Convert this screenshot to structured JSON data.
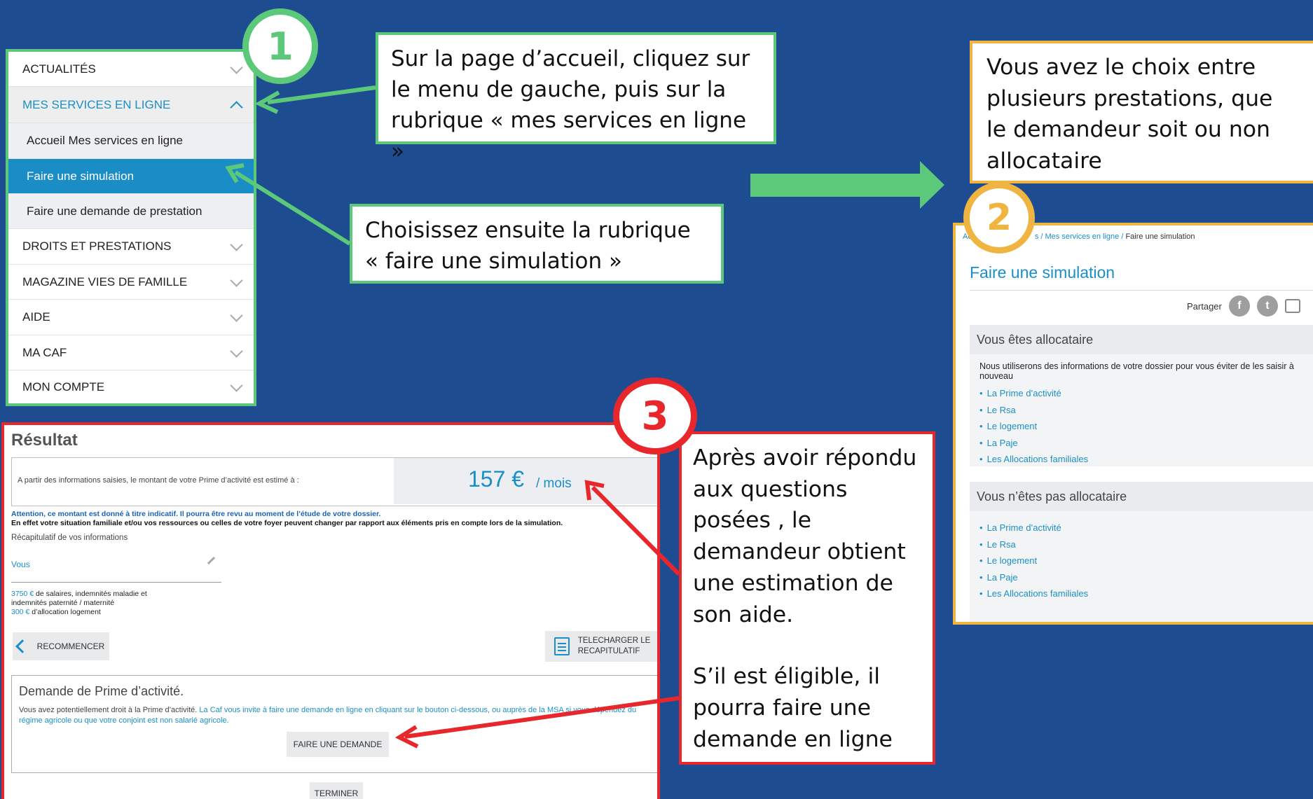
{
  "menu": {
    "items": [
      {
        "label": "ACTUALITÉS",
        "state": "collapsed"
      },
      {
        "label": "MES SERVICES EN LIGNE",
        "state": "expanded"
      },
      {
        "label": "Accueil Mes services en ligne",
        "state": "subitem"
      },
      {
        "label": "Faire une simulation",
        "state": "selected"
      },
      {
        "label": "Faire une demande de prestation",
        "state": "subitem"
      },
      {
        "label": "DROITS ET PRESTATIONS",
        "state": "collapsed"
      },
      {
        "label": "MAGAZINE VIES DE FAMILLE",
        "state": "collapsed"
      },
      {
        "label": "AIDE",
        "state": "collapsed"
      },
      {
        "label": "MA CAF",
        "state": "collapsed"
      },
      {
        "label": "MON COMPTE",
        "state": "collapsed"
      }
    ]
  },
  "badges": {
    "one": "1",
    "two": "2",
    "three": "3"
  },
  "callouts": {
    "step1": "Sur la page d’accueil, cliquez sur le menu de gauche, puis sur la rubrique « mes services en ligne »",
    "step1b": "Choisissez ensuite la rubrique « faire une simulation »",
    "step2": "Vous avez le choix entre plusieurs prestations, que le demandeur soit ou non allocataire",
    "step3a": "Après avoir répondu aux questions posées , le demandeur obtient une estimation de son aide.",
    "step3b": "S’il est éligible, il pourra faire une demande en ligne"
  },
  "simulation_page": {
    "breadcrumb_start": "Ac",
    "breadcrumb_middle": "s / Mes services en ligne / ",
    "breadcrumb_current": "Faire une simulation",
    "title": "Faire une simulation",
    "share_label": "Partager",
    "allocataire": {
      "heading": "Vous êtes allocataire",
      "intro": "Nous utiliserons des informations de votre dossier pour vous éviter de les saisir à nouveau",
      "links": [
        "La Prime d’activité",
        "Le Rsa",
        "Le logement",
        "La Paje",
        "Les Allocations familiales"
      ]
    },
    "non_allocataire": {
      "heading": "Vous n’êtes pas allocataire",
      "links": [
        "La Prime d’activité",
        "Le Rsa",
        "Le logement",
        "La Paje",
        "Les Allocations familiales"
      ]
    }
  },
  "result": {
    "title": "Résultat",
    "estimate_text": "A partir des informations saisies, le montant de votre Prime d’activité est estimé à :",
    "amount": "157 €",
    "unit": "/ mois",
    "warning1": "Attention, ce montant est donné à titre indicatif. Il pourra être revu au moment de l’étude de votre dossier.",
    "warning2": "En effet votre situation familiale et/ou vos ressources ou celles de votre foyer peuvent changer par rapport aux éléments pris en compte lors de la simulation.",
    "recap_label": "Récapitulatif de vos informations",
    "vous_label": "Vous",
    "detail1_amount": "3750 €",
    "detail1_text": " de salaires, indemnités maladie et",
    "detail2_text": "indemnités paternité / maternité",
    "detail3_amount": "300 €",
    "detail3_text": " d’allocation logement",
    "restart_label": "RECOMMENCER",
    "download_label_1": "TELECHARGER LE",
    "download_label_2": "RECAPITULATIF",
    "request_title": "Demande de Prime d’activité.",
    "request_text_grey": "Vous avez potentiellement droit à la Prime d’activité. ",
    "request_text_blue": "La Caf vous invite à faire une demande en ligne en cliquant sur le bouton ci-dessous, ou auprès de la MSA si vous dépendez du régime agricole ou que votre conjoint est non salarié agricole.",
    "request_button": "FAIRE UNE DEMANDE",
    "finish_button": "TERMINER"
  },
  "colors": {
    "background": "#1d4c91",
    "step1_green": "#5cc879",
    "step2_orange": "#f0b540",
    "step3_red": "#e8272c",
    "caf_blue": "#1a8fc7"
  }
}
